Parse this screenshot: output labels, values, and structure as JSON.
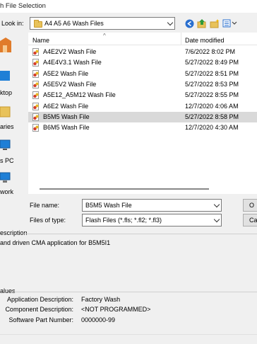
{
  "window": {
    "title": "h File Selection"
  },
  "lookin": {
    "label": "Look in:",
    "value": "A4 A5 A6 Wash Files"
  },
  "places": [
    {
      "label": "",
      "icon": "recent-places-icon"
    },
    {
      "label": "ktop",
      "icon": "desktop-icon"
    },
    {
      "label": "aries",
      "icon": "libraries-icon"
    },
    {
      "label": "s PC",
      "icon": "this-pc-icon"
    },
    {
      "label": "work",
      "icon": "network-icon"
    }
  ],
  "filelist": {
    "col_name": "Name",
    "col_date": "Date modified",
    "sort_glyph": "^",
    "rows": [
      {
        "name": "A4E2V2 Wash File",
        "date": "7/6/2022 8:02 PM"
      },
      {
        "name": "A4E4V3.1 Wash File",
        "date": "5/27/2022 8:49 PM"
      },
      {
        "name": "A5E2 Wash File",
        "date": "5/27/2022 8:51 PM"
      },
      {
        "name": "A5E5V2 Wash File",
        "date": "5/27/2022 8:53 PM"
      },
      {
        "name": "A5E12_A5M12 Wash File",
        "date": "5/27/2022 8:55 PM"
      },
      {
        "name": "A6E2 Wash File",
        "date": "12/7/2020 4:06 AM"
      },
      {
        "name": "B5M5 Wash File",
        "date": "5/27/2022 8:58 PM"
      },
      {
        "name": "B6M5 Wash File",
        "date": "12/7/2020 4:30 AM"
      }
    ],
    "selected_index": 6
  },
  "filename": {
    "label": "File name:",
    "value": "B5M5 Wash File"
  },
  "filetype": {
    "label": "Files of type:",
    "value": "Flash Files (*.fls; *.fl2; *.fl3)"
  },
  "buttons": {
    "open": "O",
    "cancel": "Ca"
  },
  "description": {
    "heading": "escription",
    "text": "and driven CMA application for B5M5I1"
  },
  "values": {
    "heading": "alues",
    "rows": [
      {
        "label": "Application Description:",
        "value": "Factory Wash"
      },
      {
        "label": "Component Description:",
        "value": "<NOT PROGRAMMED>"
      },
      {
        "label": "Software Part Number:",
        "value": "0000000-99"
      }
    ]
  },
  "colors": {
    "selection": "#d9d9d9",
    "folder": "#e8c25a",
    "accent_blue": "#2a6fcf",
    "green": "#2f9a3a"
  }
}
